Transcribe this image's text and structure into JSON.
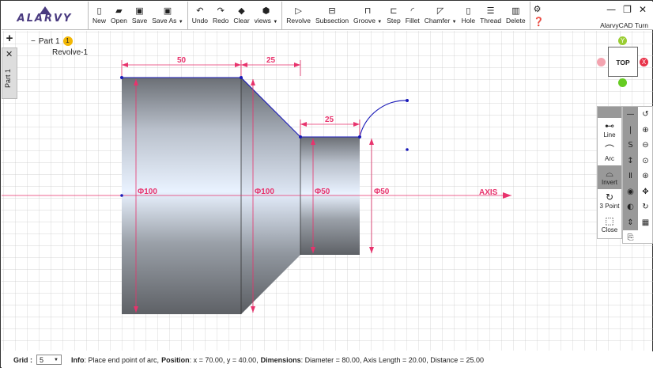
{
  "app": {
    "brand": "ALARVY",
    "title": "AlarvyCAD Turn"
  },
  "toolbar": {
    "file": [
      {
        "id": "new",
        "label": "New",
        "icon": "file-new-icon"
      },
      {
        "id": "open",
        "label": "Open",
        "icon": "folder-open-icon"
      },
      {
        "id": "save",
        "label": "Save",
        "icon": "floppy-icon"
      },
      {
        "id": "saveas",
        "label": "Save As",
        "icon": "floppy-export-icon"
      }
    ],
    "edit": [
      {
        "id": "undo",
        "label": "Undo",
        "icon": "undo-icon"
      },
      {
        "id": "redo",
        "label": "Redo",
        "icon": "redo-icon"
      },
      {
        "id": "clear",
        "label": "Clear",
        "icon": "eraser-icon"
      },
      {
        "id": "views",
        "label": "views",
        "icon": "cube-icon"
      }
    ],
    "features": [
      {
        "id": "revolve",
        "label": "Revolve",
        "icon": "revolve-icon"
      },
      {
        "id": "subsection",
        "label": "Subsection",
        "icon": "subsection-icon"
      },
      {
        "id": "groove",
        "label": "Groove",
        "icon": "groove-icon"
      },
      {
        "id": "step",
        "label": "Step",
        "icon": "step-icon"
      },
      {
        "id": "fillet",
        "label": "Fillet",
        "icon": "fillet-icon"
      },
      {
        "id": "chamfer",
        "label": "Chamfer",
        "icon": "chamfer-icon"
      },
      {
        "id": "hole",
        "label": "Hole",
        "icon": "hole-icon"
      },
      {
        "id": "thread",
        "label": "Thread",
        "icon": "thread-icon"
      },
      {
        "id": "delete",
        "label": "Delete",
        "icon": "trash-icon"
      }
    ]
  },
  "tree": {
    "tab_label": "Part 1",
    "part": "Part 1",
    "part_badge": "1",
    "feature": "Revolve-1"
  },
  "viewcube": {
    "face": "TOP",
    "y_axis": "Y",
    "x_axis": "X"
  },
  "sketch_tools": [
    {
      "label": "Line",
      "icon": "line-icon"
    },
    {
      "label": "Arc",
      "icon": "arc-icon"
    },
    {
      "label": "Invert",
      "icon": "invert-arc-icon",
      "active": true
    },
    {
      "label": "3 Point",
      "icon": "three-point-arc-icon"
    },
    {
      "label": "Close",
      "icon": "close-shape-icon"
    }
  ],
  "drawing": {
    "axis_label": "AXIS",
    "dims": {
      "len1": "50",
      "len2": "25",
      "len3": "25",
      "dia1": "Φ100",
      "dia2": "Φ100",
      "dia3": "Φ50",
      "dia4": "Φ50"
    },
    "colors": {
      "dimension": "#e8336d",
      "sketch": "#1a1ab8",
      "grid": "#bdbdbd",
      "axis": "#e8336d"
    }
  },
  "status": {
    "grid_label": "Grid :",
    "grid_value": "5",
    "info_label": "Info",
    "info_text": ": Place end point of arc,",
    "position_label": "Position",
    "position_text": ": x = 70.00, y = 40.00,",
    "dimensions_label": "Dimensions",
    "dimensions_text": ": Diameter = 80.00, Axis Length = 20.00, Distance = 25.00"
  }
}
